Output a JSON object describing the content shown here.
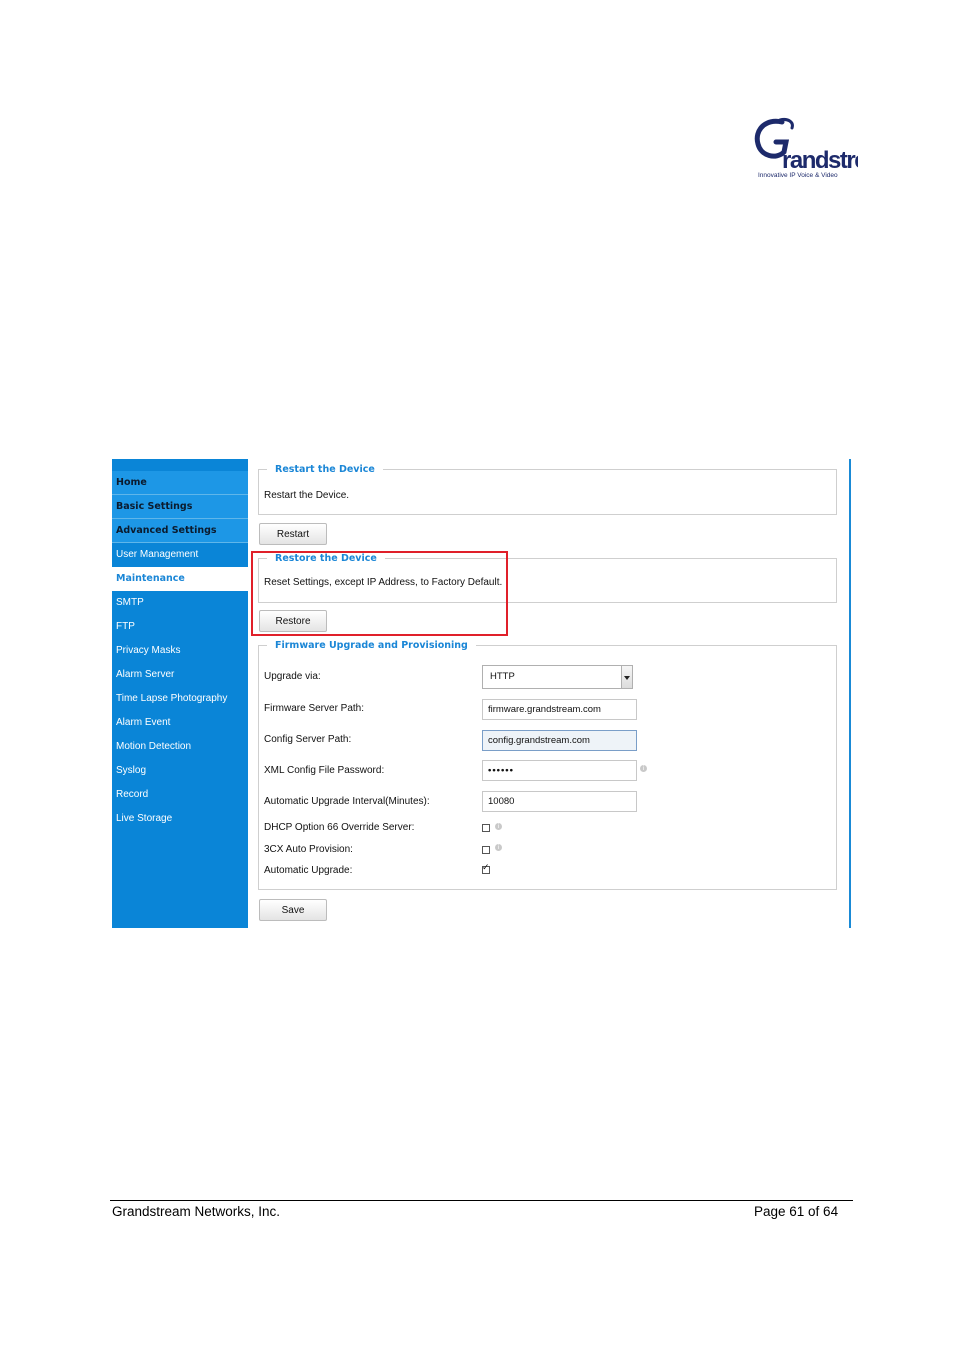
{
  "brand": {
    "tagline": "Innovative IP Voice & Video",
    "primary_color": "#0a85d7",
    "accent_color": "#1a86d6",
    "highlight_color": "#e0202a"
  },
  "sidebar": {
    "items": [
      {
        "label": "Home"
      },
      {
        "label": "Basic Settings"
      },
      {
        "label": "Advanced Settings"
      },
      {
        "label": "User Management"
      },
      {
        "label": "Maintenance"
      },
      {
        "label": "SMTP"
      },
      {
        "label": "FTP"
      },
      {
        "label": "Privacy Masks"
      },
      {
        "label": "Alarm Server"
      },
      {
        "label": "Time Lapse Photography"
      },
      {
        "label": "Alarm Event"
      },
      {
        "label": "Motion Detection"
      },
      {
        "label": "Syslog"
      },
      {
        "label": "Record"
      },
      {
        "label": "Live Storage"
      }
    ]
  },
  "restart": {
    "legend": "Restart the Device",
    "description": "Restart the Device.",
    "button": "Restart"
  },
  "restore": {
    "legend": "Restore the Device",
    "description": "Reset Settings, except IP Address, to Factory Default.",
    "button": "Restore"
  },
  "firmware": {
    "legend": "Firmware Upgrade and Provisioning",
    "upgrade_via_label": "Upgrade via:",
    "upgrade_via_value": "HTTP",
    "firmware_path_label": "Firmware Server Path:",
    "firmware_path_value": "firmware.grandstream.com",
    "config_path_label": "Config Server Path:",
    "config_path_value": "config.grandstream.com",
    "xml_password_label": "XML Config File Password:",
    "xml_password_value": "••••••",
    "interval_label": "Automatic Upgrade Interval(Minutes):",
    "interval_value": "10080",
    "dhcp66_label": "DHCP Option 66 Override Server:",
    "dhcp66_checked": false,
    "3cx_label": "3CX Auto Provision:",
    "3cx_checked": false,
    "auto_upgrade_label": "Automatic Upgrade:",
    "auto_upgrade_checked": true,
    "save_button": "Save"
  },
  "footer": {
    "company": "Grandstream Networks, Inc.",
    "page": "Page 61 of 64"
  }
}
